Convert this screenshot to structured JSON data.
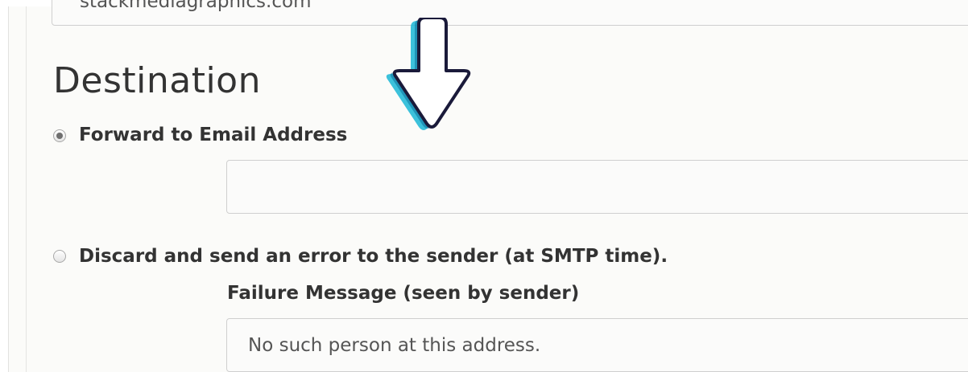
{
  "domain_field": {
    "value": "stackmediagraphics.com"
  },
  "destination": {
    "heading": "Destination",
    "forward_option": {
      "label": "Forward to Email Address",
      "selected": true
    },
    "forward_input": {
      "value": "",
      "placeholder": ""
    },
    "discard_option": {
      "label": "Discard and send an error to the sender (at SMTP time).",
      "selected": false
    },
    "failure_message": {
      "label": "Failure Message (seen by sender)",
      "value": "No such person at this address."
    }
  },
  "overlay": {
    "icon": "arrow-down-icon",
    "colors": {
      "fill": "#ffffff",
      "outline": "#1a1a3a",
      "shadow": "#00bcd4"
    }
  }
}
